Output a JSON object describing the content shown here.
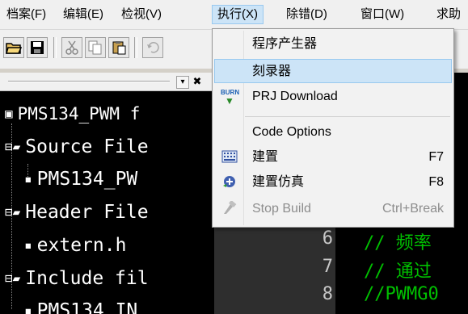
{
  "menubar": {
    "items": [
      "档案(F)",
      "编辑(E)",
      "检视(V)",
      "执行(X)",
      "除错(D)",
      "窗口(W)",
      "求助"
    ]
  },
  "toolbar": {
    "buttons": [
      "open-icon",
      "save-icon",
      "cut-icon",
      "copy-icon",
      "paste-icon",
      "undo-icon"
    ]
  },
  "panel": {
    "dock_button": "▾",
    "close_button": "✖"
  },
  "tree": {
    "nodes": [
      {
        "label": "PMS134_PWM f",
        "icon": "project-icon"
      },
      {
        "label": "Source File",
        "icon": "folder-icon"
      },
      {
        "label": "PMS134_PW",
        "icon": "file-icon"
      },
      {
        "label": "Header File",
        "icon": "folder-icon"
      },
      {
        "label": "extern.h",
        "icon": "file-icon"
      },
      {
        "label": "Include fil",
        "icon": "folder-icon"
      },
      {
        "label": "PMS134_IN",
        "icon": "file-icon"
      }
    ]
  },
  "editor": {
    "lines": [
      {
        "num": "6",
        "code": "//  频率"
      },
      {
        "num": "7",
        "code": "//  通过"
      },
      {
        "num": "8",
        "code": "//PWMG0"
      }
    ]
  },
  "dropdown": {
    "items": [
      {
        "label": "程序产生器",
        "shortcut": "",
        "icon": ""
      },
      {
        "label": "刻录器",
        "shortcut": "",
        "icon": ""
      },
      {
        "label": "PRJ Download",
        "shortcut": "",
        "icon": "burn-icon",
        "icon_text": "BURN"
      },
      {
        "label": "Code Options",
        "shortcut": "",
        "icon": ""
      },
      {
        "label": "建置",
        "shortcut": "F7",
        "icon": "build-icon"
      },
      {
        "label": "建置仿真",
        "shortcut": "F8",
        "icon": "build-emulate-icon"
      },
      {
        "label": "Stop Build",
        "shortcut": "Ctrl+Break",
        "icon": "stop-build-icon"
      }
    ]
  },
  "colors": {
    "highlight": "#cce4f7",
    "highlight_border": "#99c9ef",
    "code_green": "#00c000",
    "tree_bg": "#000000"
  }
}
